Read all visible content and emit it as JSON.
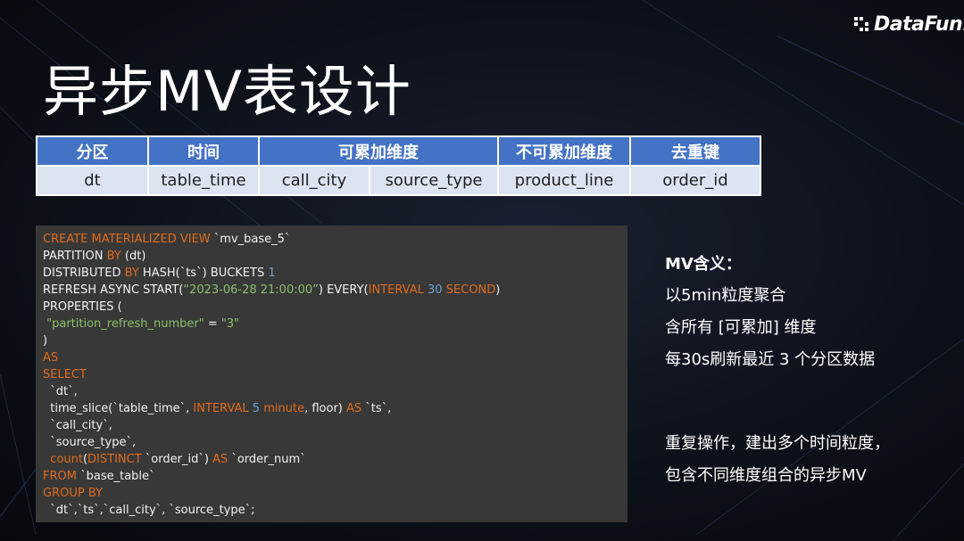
{
  "slide": {
    "title": "异步MV表设计",
    "logo_text": "DataFun.",
    "logo_icon": "datafun-dots-icon"
  },
  "table": {
    "header": [
      "分区",
      "时间",
      "可累加维度",
      "不可累加维度",
      "去重键"
    ],
    "row": [
      "dt",
      "table_time",
      "call_city",
      "source_type",
      "product_line",
      "order_id"
    ]
  },
  "code_lines": [
    [
      {
        "t": "CREATE MATERIALIZED VIEW",
        "c": "kw"
      },
      {
        "t": " `mv_base_5`",
        "c": ""
      }
    ],
    [
      {
        "t": "PARTITION ",
        "c": ""
      },
      {
        "t": "BY",
        "c": "kw"
      },
      {
        "t": " (dt)",
        "c": ""
      }
    ],
    [
      {
        "t": "DISTRIBUTED ",
        "c": ""
      },
      {
        "t": "BY",
        "c": "kw"
      },
      {
        "t": " HASH(`ts`) BUCKETS ",
        "c": ""
      },
      {
        "t": "1",
        "c": "num"
      }
    ],
    [
      {
        "t": "REFRESH ASYNC START(",
        "c": ""
      },
      {
        "t": "“2023-06-28 21:00:00”",
        "c": "str"
      },
      {
        "t": ") EVERY(",
        "c": ""
      },
      {
        "t": "INTERVAL",
        "c": "kw"
      },
      {
        "t": " ",
        "c": ""
      },
      {
        "t": "30",
        "c": "num"
      },
      {
        "t": " ",
        "c": ""
      },
      {
        "t": "SECOND",
        "c": "kw"
      },
      {
        "t": ")",
        "c": ""
      }
    ],
    [
      {
        "t": "PROPERTIES (",
        "c": ""
      }
    ],
    [
      {
        "t": " ",
        "c": ""
      },
      {
        "t": "\"partition_refresh_number\"",
        "c": "str"
      },
      {
        "t": " = ",
        "c": ""
      },
      {
        "t": "\"3\"",
        "c": "str"
      }
    ],
    [
      {
        "t": ")",
        "c": ""
      }
    ],
    [
      {
        "t": "AS",
        "c": "kw"
      }
    ],
    [
      {
        "t": "SELECT",
        "c": "kw"
      }
    ],
    [
      {
        "t": "  `dt`,",
        "c": ""
      }
    ],
    [
      {
        "t": "  time_slice(`table_time`, ",
        "c": ""
      },
      {
        "t": "INTERVAL",
        "c": "kw"
      },
      {
        "t": " ",
        "c": ""
      },
      {
        "t": "5",
        "c": "num"
      },
      {
        "t": " ",
        "c": ""
      },
      {
        "t": "minute",
        "c": "kw"
      },
      {
        "t": ", floor) ",
        "c": ""
      },
      {
        "t": "AS",
        "c": "kw"
      },
      {
        "t": " `ts`,",
        "c": ""
      }
    ],
    [
      {
        "t": "  `call_city`,",
        "c": ""
      }
    ],
    [
      {
        "t": "  `source_type`,",
        "c": ""
      }
    ],
    [
      {
        "t": "  count",
        "c": "kw"
      },
      {
        "t": "(",
        "c": ""
      },
      {
        "t": "DISTINCT",
        "c": "kw"
      },
      {
        "t": " `order_id`) ",
        "c": ""
      },
      {
        "t": "AS",
        "c": "kw"
      },
      {
        "t": " `order_num`",
        "c": ""
      }
    ],
    [
      {
        "t": "FROM",
        "c": "kw"
      },
      {
        "t": " `base_table`",
        "c": ""
      }
    ],
    [
      {
        "t": "GROUP BY",
        "c": "kw"
      }
    ],
    [
      {
        "t": "  `dt`,`ts`,`call_city`, `source_type`;",
        "c": ""
      }
    ]
  ],
  "side": {
    "heading": "MV含义：",
    "lines": [
      "以5min粒度聚合",
      "含所有 [可累加] 维度",
      "每30s刷新最近 3 个分区数据"
    ],
    "summary": [
      "重复操作，建出多个时间粒度，",
      "包含不同维度组合的异步MV"
    ]
  }
}
